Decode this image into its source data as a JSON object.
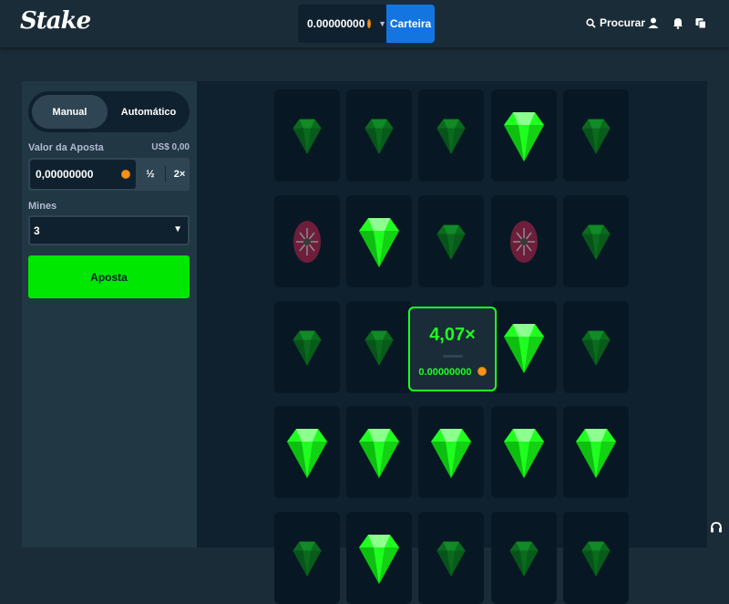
{
  "header": {
    "logo": "Stake",
    "balance": "0.00000000",
    "wallet_label": "Carteira",
    "search_label": "Procurar"
  },
  "sidebar": {
    "mode_manual": "Manual",
    "mode_auto": "Automático",
    "bet_label": "Valor da Aposta",
    "bet_usd": "US$ 0,00",
    "bet_value": "0,00000000",
    "half_label": "½",
    "double_label": "2×",
    "mines_label": "Mines",
    "mines_value": "3",
    "bet_button": "Aposta"
  },
  "game": {
    "multiplier": "4,07×",
    "payout": "0.00000000",
    "tiles": [
      [
        "gem-dim",
        "gem-dim",
        "gem-dim",
        "gem-bright",
        "gem-dim"
      ],
      [
        "mine-dim",
        "gem-bright",
        "gem-dim",
        "mine-dim",
        "gem-dim"
      ],
      [
        "gem-dim",
        "gem-dim",
        "result",
        "gem-bright",
        "gem-dim"
      ],
      [
        "gem-bright",
        "gem-bright",
        "gem-bright",
        "gem-bright",
        "gem-bright"
      ],
      [
        "gem-dim",
        "gem-bright",
        "gem-dim",
        "gem-dim",
        "gem-dim"
      ]
    ]
  },
  "colors": {
    "accent_green": "#00e701",
    "gem_green": "#1fff20",
    "wallet_blue": "#1475e1"
  }
}
